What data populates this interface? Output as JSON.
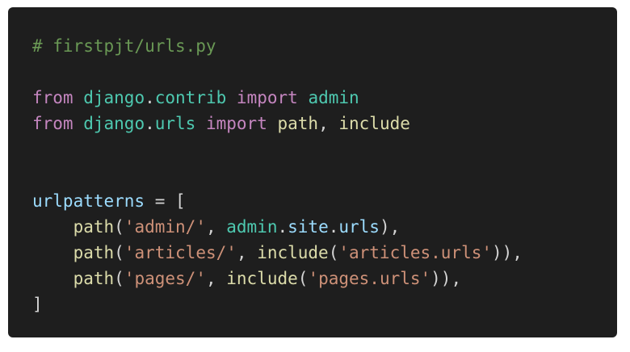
{
  "code": {
    "lines": [
      [
        {
          "text": "# firstpjt/urls.py",
          "kind": "comment"
        }
      ],
      [],
      [
        {
          "text": "from",
          "kind": "keyword"
        },
        {
          "text": " ",
          "kind": "punct"
        },
        {
          "text": "django",
          "kind": "module"
        },
        {
          "text": ".",
          "kind": "punct"
        },
        {
          "text": "contrib",
          "kind": "module"
        },
        {
          "text": " ",
          "kind": "punct"
        },
        {
          "text": "import",
          "kind": "keyword"
        },
        {
          "text": " ",
          "kind": "punct"
        },
        {
          "text": "admin",
          "kind": "module"
        }
      ],
      [
        {
          "text": "from",
          "kind": "keyword"
        },
        {
          "text": " ",
          "kind": "punct"
        },
        {
          "text": "django",
          "kind": "module"
        },
        {
          "text": ".",
          "kind": "punct"
        },
        {
          "text": "urls",
          "kind": "module"
        },
        {
          "text": " ",
          "kind": "punct"
        },
        {
          "text": "import",
          "kind": "keyword"
        },
        {
          "text": " ",
          "kind": "punct"
        },
        {
          "text": "path",
          "kind": "func"
        },
        {
          "text": ", ",
          "kind": "punct"
        },
        {
          "text": "include",
          "kind": "func"
        }
      ],
      [],
      [],
      [
        {
          "text": "urlpatterns",
          "kind": "name"
        },
        {
          "text": " = [",
          "kind": "punct"
        }
      ],
      [
        {
          "text": "    ",
          "kind": "punct"
        },
        {
          "text": "path",
          "kind": "func"
        },
        {
          "text": "(",
          "kind": "punct"
        },
        {
          "text": "'admin/'",
          "kind": "string"
        },
        {
          "text": ", ",
          "kind": "punct"
        },
        {
          "text": "admin",
          "kind": "module"
        },
        {
          "text": ".",
          "kind": "punct"
        },
        {
          "text": "site",
          "kind": "name"
        },
        {
          "text": ".",
          "kind": "punct"
        },
        {
          "text": "urls",
          "kind": "name"
        },
        {
          "text": "),",
          "kind": "punct"
        }
      ],
      [
        {
          "text": "    ",
          "kind": "punct"
        },
        {
          "text": "path",
          "kind": "func"
        },
        {
          "text": "(",
          "kind": "punct"
        },
        {
          "text": "'articles/'",
          "kind": "string"
        },
        {
          "text": ", ",
          "kind": "punct"
        },
        {
          "text": "include",
          "kind": "func"
        },
        {
          "text": "(",
          "kind": "punct"
        },
        {
          "text": "'articles.urls'",
          "kind": "string"
        },
        {
          "text": ")),",
          "kind": "punct"
        }
      ],
      [
        {
          "text": "    ",
          "kind": "punct"
        },
        {
          "text": "path",
          "kind": "func"
        },
        {
          "text": "(",
          "kind": "punct"
        },
        {
          "text": "'pages/'",
          "kind": "string"
        },
        {
          "text": ", ",
          "kind": "punct"
        },
        {
          "text": "include",
          "kind": "func"
        },
        {
          "text": "(",
          "kind": "punct"
        },
        {
          "text": "'pages.urls'",
          "kind": "string"
        },
        {
          "text": ")),",
          "kind": "punct"
        }
      ],
      [
        {
          "text": "]",
          "kind": "punct"
        }
      ]
    ]
  }
}
